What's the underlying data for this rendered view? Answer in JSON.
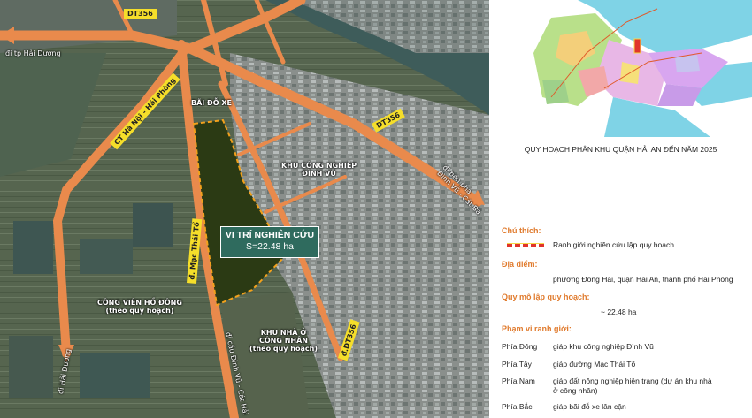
{
  "map": {
    "road_labels": {
      "dt356_top": "DT356",
      "dt356_right": "DT356",
      "dt356_bottom": "đ.DT356",
      "hanoi_haiphong": "CT Hà Nội - Hải Phòng",
      "mac_thai_to": "đ. Mạc Thái Tổ"
    },
    "directions": {
      "to_hai_duong_top": "đi tp Hải Dương",
      "to_hai_duong_bottom": "đi Hải Dương",
      "to_ben_pha": "đi bến phà\nĐình Vũ - Cát Bà",
      "to_cau_dinh_vu": "đi cầu Đình Vũ - Cát Hải"
    },
    "areas": {
      "parking": "BÃI ĐỖ XE",
      "industrial": "KHU CÔNG NGHIỆP\nĐÌNH VŨ",
      "park": "CÔNG VIÊN HỒ ĐÔNG\n(theo quy hoạch)",
      "housing": "KHU NHÀ Ở\nCÔNG NHÂN\n(theo quy hoạch)"
    },
    "study_site": {
      "title": "VỊ TRÍ NGHIÊN CỨU",
      "area": "S=22.48 ha"
    },
    "colors": {
      "road": "#e98a4c",
      "boundary": "#f2a11c",
      "site_fill": "#2b3a14",
      "label_box": "#2f6b5e"
    }
  },
  "side": {
    "inset_title": "QUY HOẠCH PHÂN KHU QUẬN HẢI AN ĐẾN NĂM 2025",
    "legend": {
      "heading": "Chú thích:",
      "item": "Ranh giới nghiên cứu lập quy hoạch"
    },
    "location": {
      "heading": "Địa điểm:",
      "value": "phường Đông Hải, quận Hải An, thành phố Hải Phòng"
    },
    "scale": {
      "heading": "Quy mô lập quy hoạch:",
      "value": "~ 22.48 ha"
    },
    "boundaries": {
      "heading": "Phạm vi ranh giới:",
      "rows": [
        {
          "dir": "Phía Đông",
          "desc": "giáp khu công nghiệp Đình Vũ"
        },
        {
          "dir": "Phía Tây",
          "desc": "giáp đường Mạc Thái Tổ"
        },
        {
          "dir": "Phía Nam",
          "desc": "giáp đất nông nghiệp hiện trạng (dự án khu nhà\nở công nhân)"
        },
        {
          "dir": "Phía Bắc",
          "desc": "giáp bãi đỗ xe lân cận"
        }
      ]
    }
  }
}
